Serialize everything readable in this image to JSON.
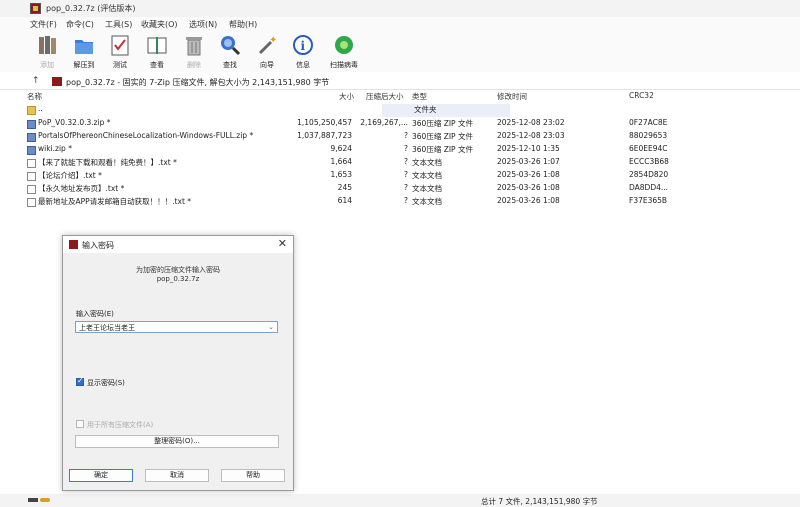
{
  "window": {
    "title": "pop_0.32.7z (评估版本)"
  },
  "menu": [
    "文件(F)",
    "命令(C)",
    "工具(S)",
    "收藏夹(O)",
    "选项(N)",
    "帮助(H)"
  ],
  "toolbar": [
    {
      "label": "添加",
      "icon": "add-books-icon",
      "enabled": false
    },
    {
      "label": "解压到",
      "icon": "folder-extract-icon",
      "enabled": true
    },
    {
      "label": "测试",
      "icon": "test-icon",
      "enabled": true
    },
    {
      "label": "查看",
      "icon": "view-icon",
      "enabled": true
    },
    {
      "label": "删除",
      "icon": "trash-icon",
      "enabled": false
    },
    {
      "label": "查找",
      "icon": "magnifier-icon",
      "enabled": true
    },
    {
      "label": "向导",
      "icon": "wand-icon",
      "enabled": true
    },
    {
      "label": "信息",
      "icon": "info-icon",
      "enabled": true
    },
    {
      "label": "扫描病毒",
      "icon": "virus-scan-icon",
      "enabled": true
    }
  ],
  "address": {
    "path": "pop_0.32.7z - 固实的 7-Zip 压缩文件, 解包大小为 2,143,151,980 字节"
  },
  "columns": {
    "name": "名称",
    "size": "大小",
    "packed": "压缩后大小",
    "type": "类型",
    "modified": "修改时间",
    "crc": "CRC32"
  },
  "files": [
    {
      "icon": "folder",
      "name": "..",
      "size": "",
      "packed": "",
      "type": "文件夹",
      "modified": "",
      "crc": ""
    },
    {
      "icon": "zip",
      "name": "PoP_V0.32.0.3.zip *",
      "size": "1,105,250,457",
      "packed": "2,169,267,...",
      "type": "360压缩 ZIP 文件",
      "modified": "2025-12-08 23:02",
      "crc": "0F27AC8E"
    },
    {
      "icon": "zip",
      "name": "PortalsOfPhereonChineseLocalization-Windows-FULL.zip *",
      "size": "1,037,887,723",
      "packed": "?",
      "type": "360压缩 ZIP 文件",
      "modified": "2025-12-08 23:03",
      "crc": "88029653"
    },
    {
      "icon": "zip",
      "name": "wiki.zip *",
      "size": "9,624",
      "packed": "?",
      "type": "360压缩 ZIP 文件",
      "modified": "2025-12-10 1:35",
      "crc": "6E0EE94C"
    },
    {
      "icon": "txt",
      "name": "【来了就能下载和观看！纯免费！】.txt *",
      "size": "1,664",
      "packed": "?",
      "type": "文本文档",
      "modified": "2025-03-26 1:07",
      "crc": "ECCC3B68"
    },
    {
      "icon": "txt",
      "name": "【论坛介绍】.txt *",
      "size": "1,653",
      "packed": "?",
      "type": "文本文档",
      "modified": "2025-03-26 1:08",
      "crc": "2854D820"
    },
    {
      "icon": "txt",
      "name": "【永久地址发布页】.txt *",
      "size": "245",
      "packed": "?",
      "type": "文本文档",
      "modified": "2025-03-26 1:08",
      "crc": "DA8DD4..."
    },
    {
      "icon": "txt",
      "name": "最新地址及APP请发邮箱自动获取！！！.txt *",
      "size": "614",
      "packed": "?",
      "type": "文本文档",
      "modified": "2025-03-26 1:08",
      "crc": "F37E365B"
    }
  ],
  "status": {
    "text": "总计 7 文件, 2,143,151,980 字节"
  },
  "dialog": {
    "title": "输入密码",
    "message_line1": "为加密的压缩文件输入密码",
    "message_line2": "pop_0.32.7z",
    "password_label": "输入密码(E)",
    "password_value": "上老王论坛当老王",
    "show_password_label": "显示密码(S)",
    "show_password_checked": true,
    "use_for_all_label": "用于所有压缩文件(A)",
    "use_for_all_checked": false,
    "organize_button": "整理密码(O)...",
    "ok_button": "确定",
    "cancel_button": "取消",
    "help_button": "帮助"
  }
}
